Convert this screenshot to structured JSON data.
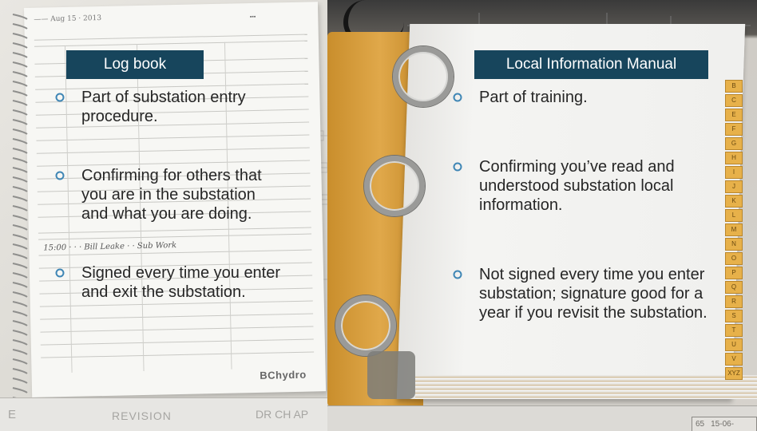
{
  "log_book": {
    "title": "Log book",
    "bullets": [
      "Part of substation entry procedure.",
      "Confirming for others that you are in the substation and what you are doing.",
      "Signed every time you enter and exit the substation."
    ],
    "photo": {
      "notebook_brand": "BChydro",
      "bottom_sheet_text": "REVISION",
      "bottom_sheet_letter": "E",
      "bottom_sheet_cols": "DR CH AP"
    }
  },
  "local_information_manual": {
    "title": "Local Information Manual",
    "bullets": [
      "Part of training.",
      "Confirming you’ve read and understood substation local information.",
      "Not signed every time you enter substation; signature good for a year if you revisit the substation."
    ],
    "photo": {
      "stamp_left": "65",
      "stamp_right": "15-06-"
    }
  },
  "colors": {
    "title_bg": "#17455c",
    "title_text": "#ffffff",
    "bullet_marker": "#3f86b5",
    "body_text": "#262626"
  },
  "icons": {
    "bullet_marker": "circle-bullet-icon"
  }
}
